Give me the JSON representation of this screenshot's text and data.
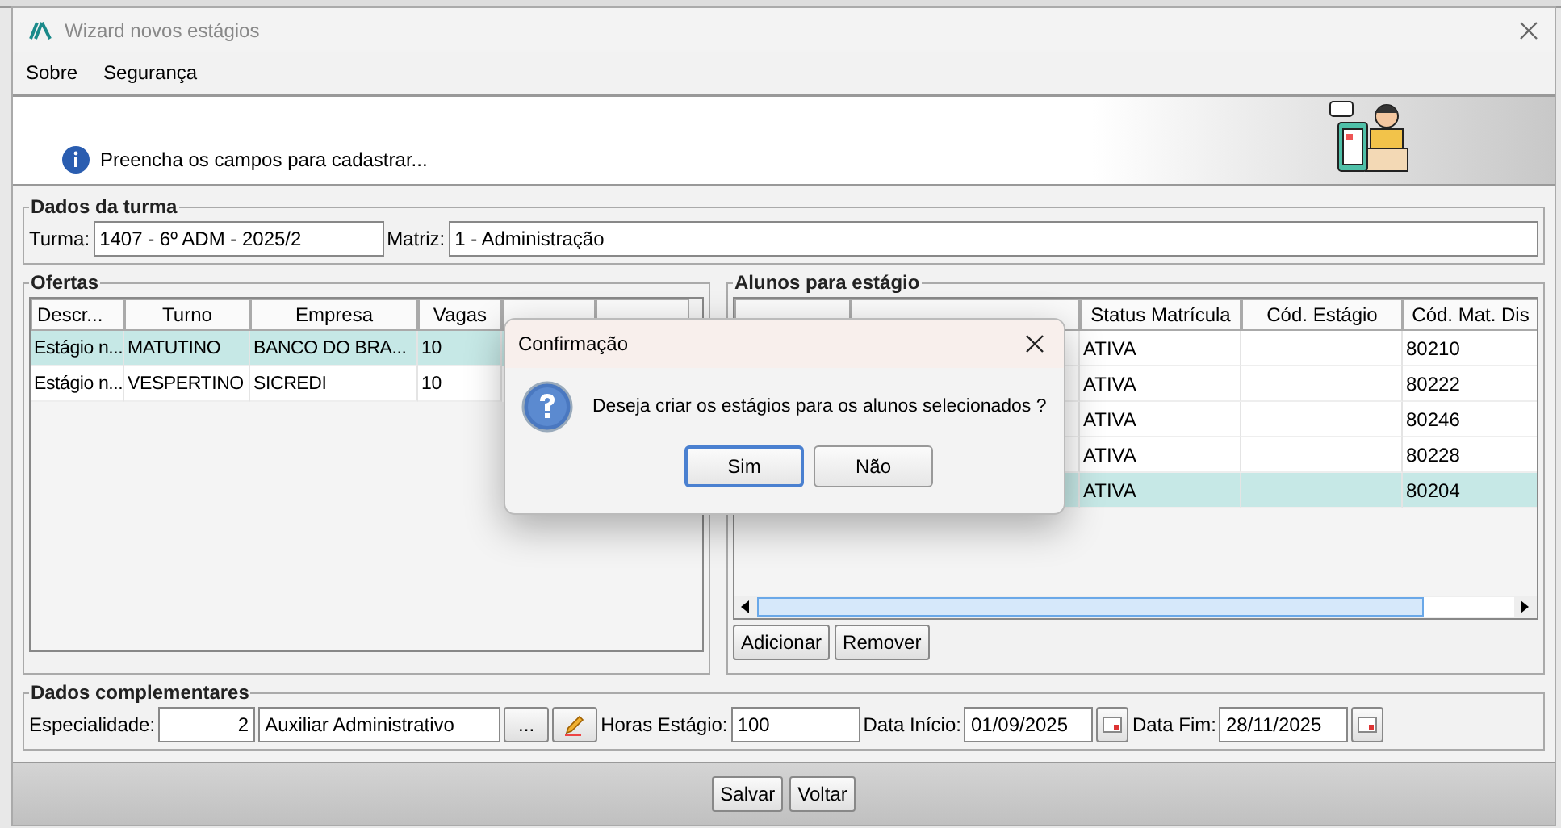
{
  "window": {
    "title": "Wizard novos estágios"
  },
  "menu": [
    {
      "label": "Sobre"
    },
    {
      "label": "Segurança"
    }
  ],
  "banner": {
    "message": "Preencha os campos para cadastrar..."
  },
  "turma": {
    "legend": "Dados da turma",
    "turma_label": "Turma:",
    "turma_value": "1407 - 6º ADM - 2025/2",
    "matriz_label": "Matriz:",
    "matriz_value": "1 - Administração"
  },
  "ofertas": {
    "legend": "Ofertas",
    "columns": [
      "Descr...",
      "Turno",
      "Empresa",
      "Vagas"
    ],
    "rows": [
      {
        "cells": [
          "Estágio n...",
          "MATUTINO",
          "BANCO DO BRA...",
          "10"
        ],
        "selected": true
      },
      {
        "cells": [
          "Estágio n...",
          "VESPERTINO",
          "SICREDI",
          "10"
        ],
        "selected": false
      }
    ]
  },
  "alunos": {
    "legend": "Alunos para estágio",
    "columns": [
      "Status Matrícula",
      "Cód. Estágio",
      "Cód. Mat. Dis"
    ],
    "rows": [
      {
        "cells": [
          "ATIVA",
          "",
          "80210"
        ],
        "selected": false
      },
      {
        "cells": [
          "ATIVA",
          "",
          "80222"
        ],
        "selected": false
      },
      {
        "cells": [
          "ATIVA",
          "",
          "80246"
        ],
        "selected": false
      },
      {
        "cells": [
          "ATIVA",
          "",
          "80228"
        ],
        "selected": false
      },
      {
        "cells": [
          "ATIVA",
          "",
          "80204"
        ],
        "selected": true
      }
    ],
    "buttons": [
      "Adicionar",
      "Remover"
    ]
  },
  "complementares": {
    "legend": "Dados complementares",
    "especialidade_label": "Especialidade:",
    "especialidade_code": "2",
    "especialidade_name": "Auxiliar Administrativo",
    "browse_button": "...",
    "horas_label": "Horas Estágio:",
    "horas_value": "100",
    "inicio_label": "Data Início:",
    "inicio_value": "01/09/2025",
    "fim_label": "Data Fim:",
    "fim_value": "28/11/2025"
  },
  "footer_buttons": [
    {
      "label": "Salvar"
    },
    {
      "label": "Voltar"
    }
  ],
  "dialog": {
    "title": "Confirmação",
    "message": "Deseja criar os estágios para os alunos selecionados ?",
    "buttons": [
      {
        "label": "Sim",
        "selected": true
      },
      {
        "label": "Não",
        "selected": false
      }
    ]
  }
}
